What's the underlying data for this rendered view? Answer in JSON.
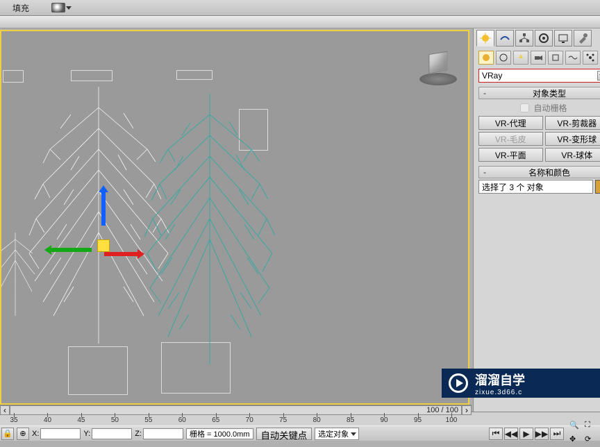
{
  "toolbar": {
    "fill_label": "填充"
  },
  "panel": {
    "renderer": "VRay",
    "rollout_object_type": "对象类型",
    "autogrid": "自动栅格",
    "buttons": {
      "vr_proxy": "VR-代理",
      "vr_clipper": "VR-剪裁器",
      "vr_fur": "VR-毛皮",
      "vr_metaball": "VR-变形球",
      "vr_plane": "VR-平面",
      "vr_sphere": "VR-球体"
    },
    "rollout_name_color": "名称和颜色",
    "selection_text": "选择了 3 个 对象"
  },
  "timeline": {
    "frame_display": "100 / 100",
    "ticks": [
      "35",
      "40",
      "45",
      "50",
      "55",
      "60",
      "65",
      "70",
      "75",
      "80",
      "85",
      "90",
      "95",
      "100"
    ]
  },
  "status": {
    "x_label": "X:",
    "y_label": "Y:",
    "z_label": "Z:",
    "grid_label": "栅格 = 1000.0mm",
    "autokey": "自动关键点",
    "keyfilter": "选定对象"
  },
  "watermark": {
    "brand": "溜溜自学",
    "url": "zixue.3d66.c"
  }
}
